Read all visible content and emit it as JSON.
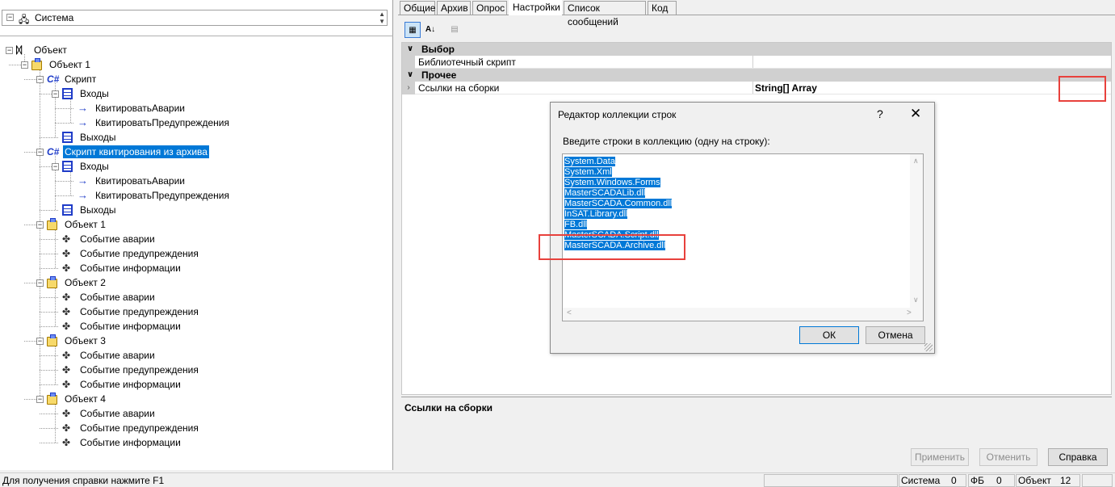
{
  "left": {
    "system_label": "Система",
    "tree": [
      {
        "label": "Объект",
        "level": 0,
        "icon": "root-icon",
        "expander": "minus"
      },
      {
        "label": "Объект 1",
        "level": 1,
        "icon": "object-icon",
        "expander": "minus"
      },
      {
        "label": "Скрипт",
        "level": 2,
        "icon": "csharp-icon",
        "expander": "minus"
      },
      {
        "label": "Входы",
        "level": 3,
        "icon": "inputs-icon",
        "expander": "minus"
      },
      {
        "label": "КвитироватьАварии",
        "level": 4,
        "icon": "input-arrow-icon",
        "expander": ""
      },
      {
        "label": "КвитироватьПредупреждения",
        "level": 4,
        "icon": "input-arrow-icon",
        "expander": ""
      },
      {
        "label": "Выходы",
        "level": 3,
        "icon": "outputs-icon",
        "expander": ""
      },
      {
        "label": "Скрипт квитирования из архива",
        "level": 2,
        "icon": "csharp-icon",
        "expander": "minus",
        "selected": true
      },
      {
        "label": "Входы",
        "level": 3,
        "icon": "inputs-icon",
        "expander": "minus"
      },
      {
        "label": "КвитироватьАварии",
        "level": 4,
        "icon": "input-arrow-icon",
        "expander": ""
      },
      {
        "label": "КвитироватьПредупреждения",
        "level": 4,
        "icon": "input-arrow-icon",
        "expander": ""
      },
      {
        "label": "Выходы",
        "level": 3,
        "icon": "outputs-icon",
        "expander": ""
      },
      {
        "label": "Объект 1",
        "level": 2,
        "icon": "object-icon",
        "expander": "minus"
      },
      {
        "label": "Событие аварии",
        "level": 3,
        "icon": "event-icon",
        "expander": ""
      },
      {
        "label": "Событие предупреждения",
        "level": 3,
        "icon": "event-icon",
        "expander": ""
      },
      {
        "label": "Событие информации",
        "level": 3,
        "icon": "event-icon",
        "expander": ""
      },
      {
        "label": "Объект 2",
        "level": 2,
        "icon": "object-icon",
        "expander": "minus"
      },
      {
        "label": "Событие аварии",
        "level": 3,
        "icon": "event-icon",
        "expander": ""
      },
      {
        "label": "Событие предупреждения",
        "level": 3,
        "icon": "event-icon",
        "expander": ""
      },
      {
        "label": "Событие информации",
        "level": 3,
        "icon": "event-icon",
        "expander": ""
      },
      {
        "label": "Объект 3",
        "level": 2,
        "icon": "object-icon",
        "expander": "minus"
      },
      {
        "label": "Событие аварии",
        "level": 3,
        "icon": "event-icon",
        "expander": ""
      },
      {
        "label": "Событие предупреждения",
        "level": 3,
        "icon": "event-icon",
        "expander": ""
      },
      {
        "label": "Событие информации",
        "level": 3,
        "icon": "event-icon",
        "expander": ""
      },
      {
        "label": "Объект 4",
        "level": 2,
        "icon": "object-icon",
        "expander": "minus"
      },
      {
        "label": "Событие аварии",
        "level": 3,
        "icon": "event-icon",
        "expander": ""
      },
      {
        "label": "Событие предупреждения",
        "level": 3,
        "icon": "event-icon",
        "expander": ""
      },
      {
        "label": "Событие информации",
        "level": 3,
        "icon": "event-icon",
        "expander": ""
      }
    ]
  },
  "tabs": [
    {
      "label": "Общие",
      "active": false
    },
    {
      "label": "Архив",
      "active": false
    },
    {
      "label": "Опрос",
      "active": false
    },
    {
      "label": "Настройки",
      "active": true
    },
    {
      "label": "Список сообщений",
      "active": false
    },
    {
      "label": "Код",
      "active": false
    }
  ],
  "toolbar": {
    "categorized_icon": "categorized-icon",
    "alphabetical_icon": "sort-az-icon",
    "pages_icon": "property-pages-icon",
    "az_glyph": "A↓"
  },
  "propgrid": {
    "cat1": "Выбор",
    "prop1_name": "Библиотечный скрипт",
    "prop1_value": "",
    "cat2": "Прочее",
    "prop2_name": "Ссылки на сборки",
    "prop2_value": "String[] Array"
  },
  "description": {
    "title": "Ссылки на сборки"
  },
  "buttons": {
    "apply": "Применить",
    "cancel": "Отменить",
    "help": "Справка"
  },
  "dialog": {
    "title": "Редактор коллекции строк",
    "help_glyph": "?",
    "close_glyph": "✕",
    "prompt": "Введите строки в коллекцию (одну на строку):",
    "lines": [
      "System.Data",
      "System.Xml",
      "System.Windows.Forms",
      "MasterSCADALib.dll",
      "MasterSCADA.Common.dll",
      "InSAT.Library.dll",
      "FB.dll",
      "MasterSCADA.Script.dll",
      "MasterSCADA.Archive.dll"
    ],
    "ok": "ОК",
    "cancel": "Отмена"
  },
  "status": {
    "help_text": "Для получения справки нажмите F1",
    "system_label": "Система",
    "system_value": "0",
    "fb_label": "ФБ",
    "fb_value": "0",
    "object_label": "Объект",
    "object_value": "12"
  },
  "colors": {
    "selection": "#0078d7",
    "highlight_box": "#e8413c",
    "category_bg": "#d0d0d0"
  }
}
